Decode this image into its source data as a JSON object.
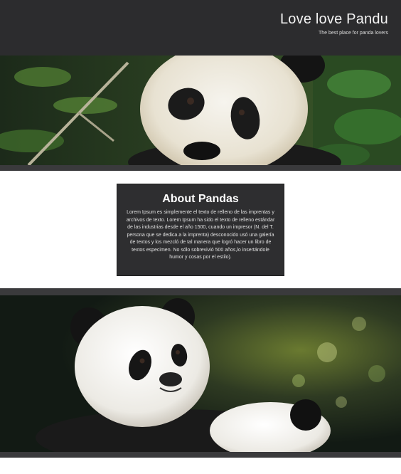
{
  "header": {
    "title": "Love love Pandu",
    "tagline": "The best place for panda lovers"
  },
  "about": {
    "title": "About Pandas",
    "body": "Lorem Ipsum es simplemente el texto de relleno de las imprentas y archivos de texto. Lorem Ipsum ha sido el texto de relleno estándar de las industrias desde el año 1500, cuando un impresor (N. del T. persona que se dedica a la imprenta) desconocido usó una galería de textos y los mezcló de tal manera que logró hacer un libro de textos especimen. No sólo sobrevivió 500 años,lo insertándole humor y cosas por el estilo)."
  },
  "images": {
    "hero_top": "panda-face-photo",
    "hero_bottom": "panda-resting-photo"
  }
}
